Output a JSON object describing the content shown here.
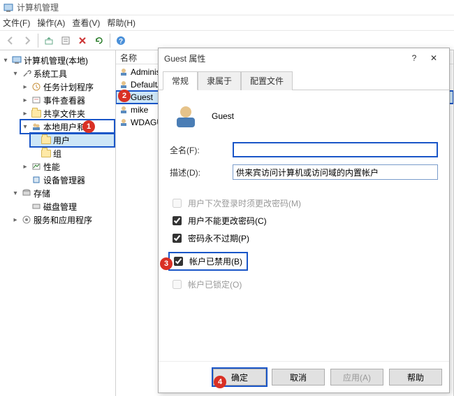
{
  "window": {
    "title": "计算机管理"
  },
  "menu": {
    "file": "文件(F)",
    "action": "操作(A)",
    "view": "查看(V)",
    "help": "帮助(H)"
  },
  "tree": {
    "root": "计算机管理(本地)",
    "system_tools": "系统工具",
    "task_scheduler": "任务计划程序",
    "event_viewer": "事件查看器",
    "shared_folders": "共享文件夹",
    "local_users_groups": "本地用户和组",
    "users": "用户",
    "groups": "组",
    "performance": "性能",
    "device_manager": "设备管理器",
    "storage": "存储",
    "disk_mgmt": "磁盘管理",
    "services_apps": "服务和应用程序"
  },
  "list": {
    "header": "名称",
    "items": [
      "Administrator",
      "DefaultAccount",
      "Guest",
      "mike",
      "WDAGUtilityAccount"
    ]
  },
  "dialog": {
    "title": "Guest 属性",
    "tabs": {
      "general": "常规",
      "member_of": "隶属于",
      "profile": "配置文件"
    },
    "username": "Guest",
    "full_name_lbl": "全名(F):",
    "full_name_val": "",
    "desc_lbl": "描述(D):",
    "desc_val": "供来宾访问计算机或访问域的内置帐户",
    "chk_must_change": "用户下次登录时须更改密码(M)",
    "chk_cannot_change": "用户不能更改密码(C)",
    "chk_never_expire": "密码永不过期(P)",
    "chk_disabled": "帐户已禁用(B)",
    "chk_locked": "帐户已锁定(O)",
    "btn_ok": "确定",
    "btn_cancel": "取消",
    "btn_apply": "应用(A)",
    "btn_help": "帮助"
  },
  "annotations": {
    "a1": "1",
    "a2": "2",
    "a3": "3",
    "a4": "4"
  }
}
